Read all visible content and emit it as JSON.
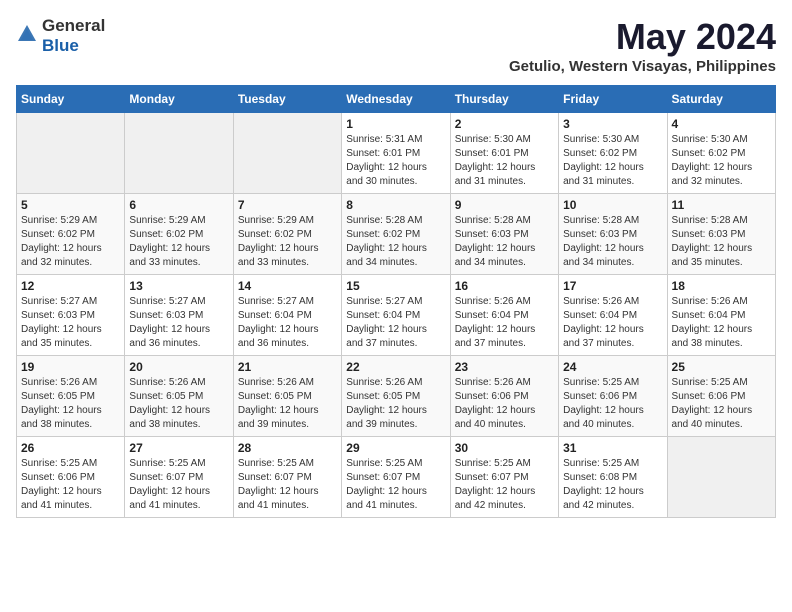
{
  "logo": {
    "text_general": "General",
    "text_blue": "Blue"
  },
  "title": "May 2024",
  "subtitle": "Getulio, Western Visayas, Philippines",
  "days_of_week": [
    "Sunday",
    "Monday",
    "Tuesday",
    "Wednesday",
    "Thursday",
    "Friday",
    "Saturday"
  ],
  "weeks": [
    [
      {
        "day": "",
        "sunrise": "",
        "sunset": "",
        "daylight": "",
        "empty": true
      },
      {
        "day": "",
        "sunrise": "",
        "sunset": "",
        "daylight": "",
        "empty": true
      },
      {
        "day": "",
        "sunrise": "",
        "sunset": "",
        "daylight": "",
        "empty": true
      },
      {
        "day": "1",
        "sunrise": "Sunrise: 5:31 AM",
        "sunset": "Sunset: 6:01 PM",
        "daylight": "Daylight: 12 hours and 30 minutes."
      },
      {
        "day": "2",
        "sunrise": "Sunrise: 5:30 AM",
        "sunset": "Sunset: 6:01 PM",
        "daylight": "Daylight: 12 hours and 31 minutes."
      },
      {
        "day": "3",
        "sunrise": "Sunrise: 5:30 AM",
        "sunset": "Sunset: 6:02 PM",
        "daylight": "Daylight: 12 hours and 31 minutes."
      },
      {
        "day": "4",
        "sunrise": "Sunrise: 5:30 AM",
        "sunset": "Sunset: 6:02 PM",
        "daylight": "Daylight: 12 hours and 32 minutes."
      }
    ],
    [
      {
        "day": "5",
        "sunrise": "Sunrise: 5:29 AM",
        "sunset": "Sunset: 6:02 PM",
        "daylight": "Daylight: 12 hours and 32 minutes."
      },
      {
        "day": "6",
        "sunrise": "Sunrise: 5:29 AM",
        "sunset": "Sunset: 6:02 PM",
        "daylight": "Daylight: 12 hours and 33 minutes."
      },
      {
        "day": "7",
        "sunrise": "Sunrise: 5:29 AM",
        "sunset": "Sunset: 6:02 PM",
        "daylight": "Daylight: 12 hours and 33 minutes."
      },
      {
        "day": "8",
        "sunrise": "Sunrise: 5:28 AM",
        "sunset": "Sunset: 6:02 PM",
        "daylight": "Daylight: 12 hours and 34 minutes."
      },
      {
        "day": "9",
        "sunrise": "Sunrise: 5:28 AM",
        "sunset": "Sunset: 6:03 PM",
        "daylight": "Daylight: 12 hours and 34 minutes."
      },
      {
        "day": "10",
        "sunrise": "Sunrise: 5:28 AM",
        "sunset": "Sunset: 6:03 PM",
        "daylight": "Daylight: 12 hours and 34 minutes."
      },
      {
        "day": "11",
        "sunrise": "Sunrise: 5:28 AM",
        "sunset": "Sunset: 6:03 PM",
        "daylight": "Daylight: 12 hours and 35 minutes."
      }
    ],
    [
      {
        "day": "12",
        "sunrise": "Sunrise: 5:27 AM",
        "sunset": "Sunset: 6:03 PM",
        "daylight": "Daylight: 12 hours and 35 minutes."
      },
      {
        "day": "13",
        "sunrise": "Sunrise: 5:27 AM",
        "sunset": "Sunset: 6:03 PM",
        "daylight": "Daylight: 12 hours and 36 minutes."
      },
      {
        "day": "14",
        "sunrise": "Sunrise: 5:27 AM",
        "sunset": "Sunset: 6:04 PM",
        "daylight": "Daylight: 12 hours and 36 minutes."
      },
      {
        "day": "15",
        "sunrise": "Sunrise: 5:27 AM",
        "sunset": "Sunset: 6:04 PM",
        "daylight": "Daylight: 12 hours and 37 minutes."
      },
      {
        "day": "16",
        "sunrise": "Sunrise: 5:26 AM",
        "sunset": "Sunset: 6:04 PM",
        "daylight": "Daylight: 12 hours and 37 minutes."
      },
      {
        "day": "17",
        "sunrise": "Sunrise: 5:26 AM",
        "sunset": "Sunset: 6:04 PM",
        "daylight": "Daylight: 12 hours and 37 minutes."
      },
      {
        "day": "18",
        "sunrise": "Sunrise: 5:26 AM",
        "sunset": "Sunset: 6:04 PM",
        "daylight": "Daylight: 12 hours and 38 minutes."
      }
    ],
    [
      {
        "day": "19",
        "sunrise": "Sunrise: 5:26 AM",
        "sunset": "Sunset: 6:05 PM",
        "daylight": "Daylight: 12 hours and 38 minutes."
      },
      {
        "day": "20",
        "sunrise": "Sunrise: 5:26 AM",
        "sunset": "Sunset: 6:05 PM",
        "daylight": "Daylight: 12 hours and 38 minutes."
      },
      {
        "day": "21",
        "sunrise": "Sunrise: 5:26 AM",
        "sunset": "Sunset: 6:05 PM",
        "daylight": "Daylight: 12 hours and 39 minutes."
      },
      {
        "day": "22",
        "sunrise": "Sunrise: 5:26 AM",
        "sunset": "Sunset: 6:05 PM",
        "daylight": "Daylight: 12 hours and 39 minutes."
      },
      {
        "day": "23",
        "sunrise": "Sunrise: 5:26 AM",
        "sunset": "Sunset: 6:06 PM",
        "daylight": "Daylight: 12 hours and 40 minutes."
      },
      {
        "day": "24",
        "sunrise": "Sunrise: 5:25 AM",
        "sunset": "Sunset: 6:06 PM",
        "daylight": "Daylight: 12 hours and 40 minutes."
      },
      {
        "day": "25",
        "sunrise": "Sunrise: 5:25 AM",
        "sunset": "Sunset: 6:06 PM",
        "daylight": "Daylight: 12 hours and 40 minutes."
      }
    ],
    [
      {
        "day": "26",
        "sunrise": "Sunrise: 5:25 AM",
        "sunset": "Sunset: 6:06 PM",
        "daylight": "Daylight: 12 hours and 41 minutes."
      },
      {
        "day": "27",
        "sunrise": "Sunrise: 5:25 AM",
        "sunset": "Sunset: 6:07 PM",
        "daylight": "Daylight: 12 hours and 41 minutes."
      },
      {
        "day": "28",
        "sunrise": "Sunrise: 5:25 AM",
        "sunset": "Sunset: 6:07 PM",
        "daylight": "Daylight: 12 hours and 41 minutes."
      },
      {
        "day": "29",
        "sunrise": "Sunrise: 5:25 AM",
        "sunset": "Sunset: 6:07 PM",
        "daylight": "Daylight: 12 hours and 41 minutes."
      },
      {
        "day": "30",
        "sunrise": "Sunrise: 5:25 AM",
        "sunset": "Sunset: 6:07 PM",
        "daylight": "Daylight: 12 hours and 42 minutes."
      },
      {
        "day": "31",
        "sunrise": "Sunrise: 5:25 AM",
        "sunset": "Sunset: 6:08 PM",
        "daylight": "Daylight: 12 hours and 42 minutes."
      },
      {
        "day": "",
        "sunrise": "",
        "sunset": "",
        "daylight": "",
        "empty": true
      }
    ]
  ]
}
